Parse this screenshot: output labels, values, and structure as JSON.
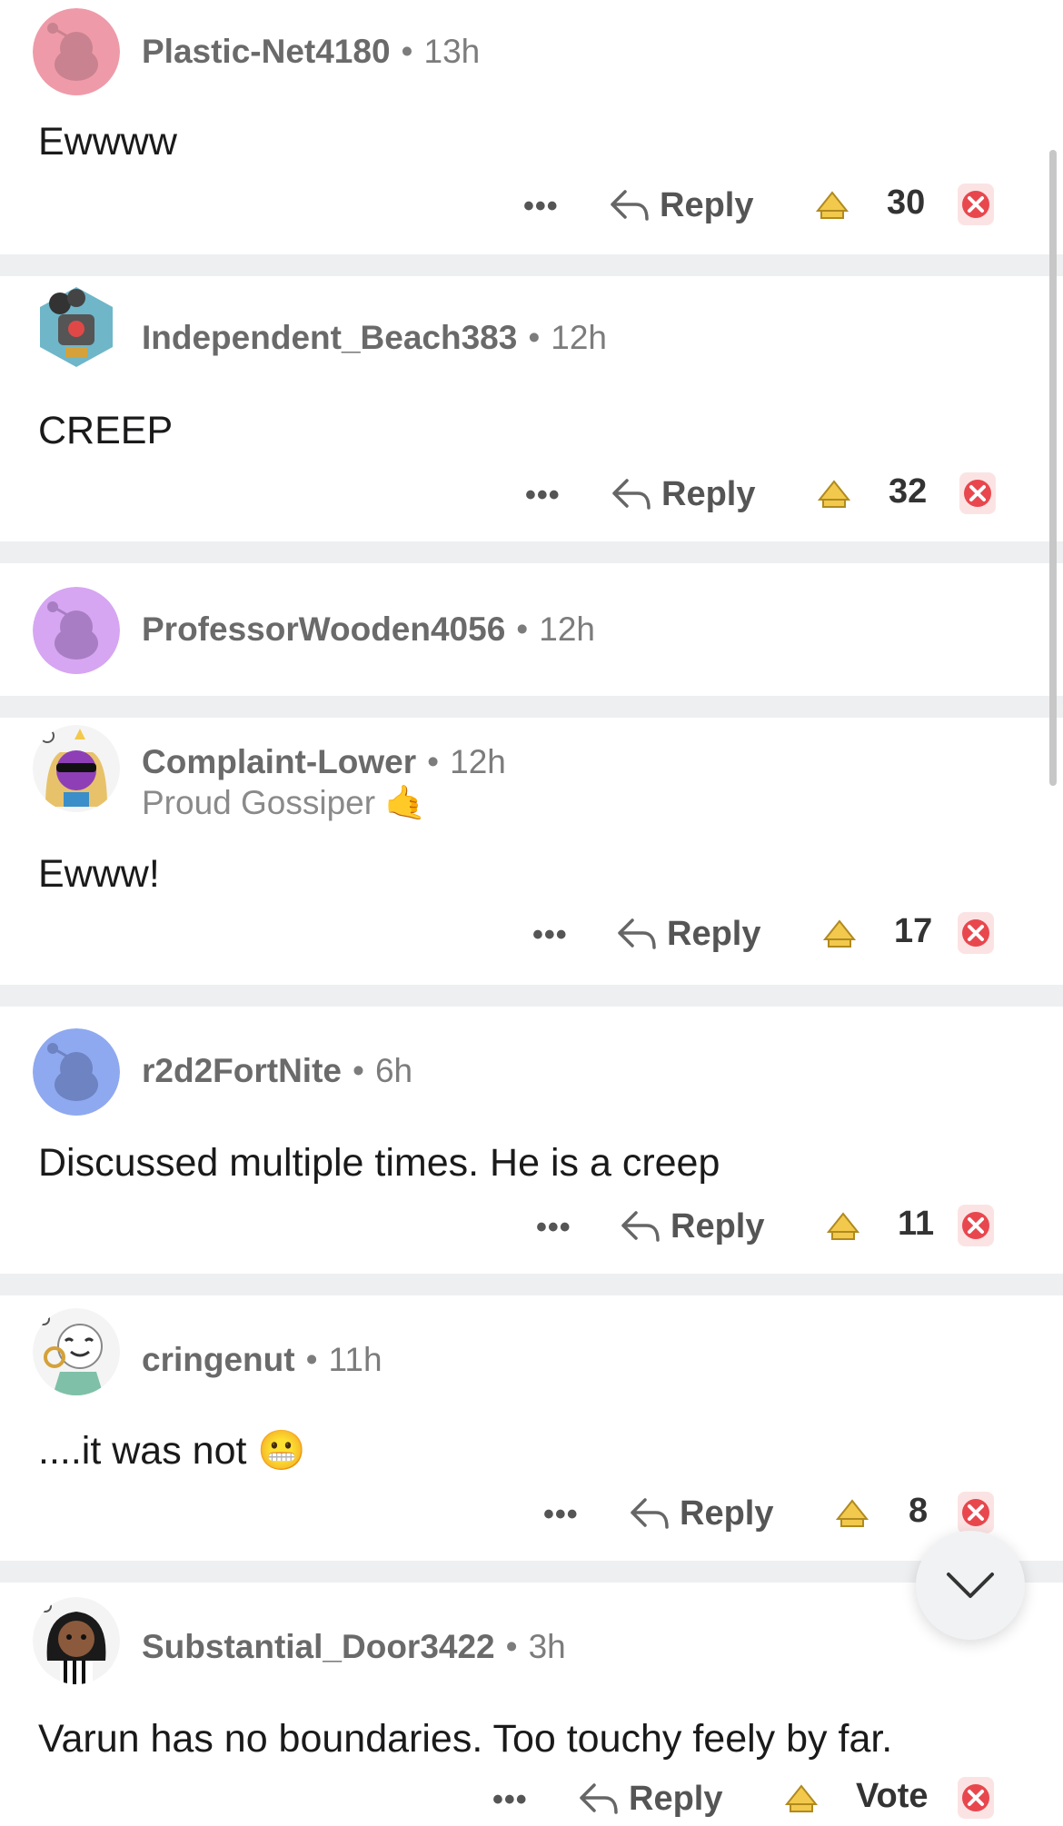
{
  "colors": {
    "separator": "#edeff1",
    "downvote": "#e8474e",
    "upvote": "#f2c94c",
    "meta_text": "#7c7c7c"
  },
  "actions": {
    "more_label": "•••",
    "reply_label": "Reply"
  },
  "comments": [
    {
      "username": "Plastic-Net4180",
      "dot": "•",
      "age": "13h",
      "text": "Ewwww",
      "score": "30",
      "avatar_icon": "snoo-pink-avatar-icon"
    },
    {
      "username": "Independent_Beach383",
      "dot": "•",
      "age": "12h",
      "text": "CREEP",
      "score": "32",
      "avatar_icon": "robot-projector-avatar-icon"
    },
    {
      "username": "ProfessorWooden4056",
      "dot": "•",
      "age": "12h",
      "text": "",
      "score": "",
      "avatar_icon": "snoo-purple-avatar-icon"
    },
    {
      "username": "Complaint-Lower",
      "dot": "•",
      "age": "12h",
      "flair": "Proud Gossiper",
      "flair_emoji": "🤙",
      "text": "Ewww!",
      "score": "17",
      "avatar_icon": "cat-sunglasses-avatar-icon"
    },
    {
      "username": "r2d2FortNite",
      "dot": "•",
      "age": "6h",
      "text": "Discussed multiple times. He is a creep",
      "score": "11",
      "avatar_icon": "snoo-blue-avatar-icon"
    },
    {
      "username": "cringenut",
      "dot": "•",
      "age": "11h",
      "text": "....it was not",
      "text_emoji": "😬",
      "score": "8",
      "avatar_icon": "snoo-headphones-avatar-icon"
    },
    {
      "username": "Substantial_Door3422",
      "dot": "•",
      "age": "3h",
      "text": "Varun has no boundaries. Too touchy feely by far.",
      "score": "Vote",
      "avatar_icon": "snoo-referee-avatar-icon"
    }
  ],
  "scroll_button": {
    "icon": "chevron-down-icon"
  }
}
